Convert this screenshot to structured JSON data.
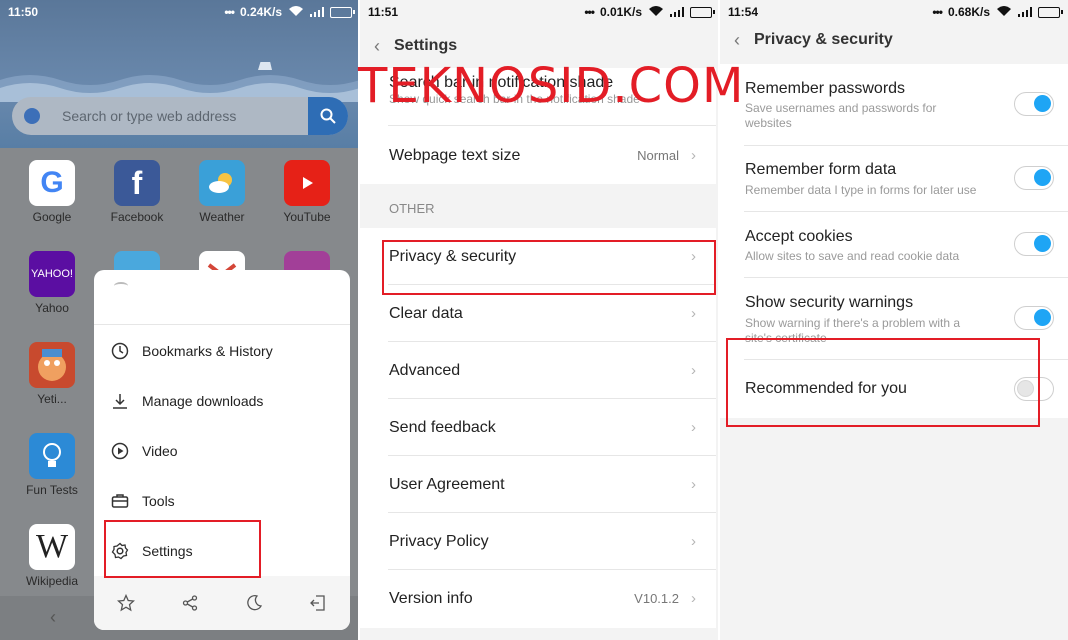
{
  "panel1": {
    "status": {
      "time": "11:50",
      "speed": "0.24K/s"
    },
    "search_placeholder": "Search or type web address",
    "apps": [
      {
        "label": "Google",
        "icon": "google-icon",
        "color": "#ffffff"
      },
      {
        "label": "Facebook",
        "icon": "facebook-icon",
        "color": "#3b5998"
      },
      {
        "label": "Weather",
        "icon": "weather-icon",
        "color": "#3aa0d8"
      },
      {
        "label": "YouTube",
        "icon": "youtube-icon",
        "color": "#e62117"
      },
      {
        "label": "Yahoo",
        "icon": "yahoo-icon",
        "color": "#5b0ea2"
      },
      {
        "label": "Yeti...",
        "icon": "yeti-icon",
        "color": "#c84a2e"
      },
      {
        "label": "Fun Tests",
        "icon": "fun-tests-icon",
        "color": "#2c8ad6"
      },
      {
        "label": "Wikipedia",
        "icon": "wikipedia-icon",
        "color": "#ffffff"
      }
    ],
    "yahoo_logo_text": "YAHOO!",
    "menu": {
      "items": [
        {
          "label": "Bookmarks & History",
          "icon": "clock-icon"
        },
        {
          "label": "Manage downloads",
          "icon": "download-icon"
        },
        {
          "label": "Video",
          "icon": "play-icon"
        },
        {
          "label": "Tools",
          "icon": "toolbox-icon"
        },
        {
          "label": "Settings",
          "icon": "gear-icon"
        }
      ],
      "bottom_icons": [
        "star-icon",
        "share-icon",
        "moon-icon",
        "exit-icon"
      ]
    }
  },
  "panel2": {
    "status": {
      "time": "11:51",
      "speed": "0.01K/s"
    },
    "title": "Settings",
    "partial_row": {
      "title": "Search bar in notification shade",
      "desc": "Show quick search bar in the notification shade"
    },
    "text_size": {
      "label": "Webpage text size",
      "value": "Normal"
    },
    "section": "OTHER",
    "rows": [
      {
        "label": "Privacy & security",
        "value": ""
      },
      {
        "label": "Clear data",
        "value": ""
      },
      {
        "label": "Advanced",
        "value": ""
      },
      {
        "label": "Send feedback",
        "value": ""
      },
      {
        "label": "User Agreement",
        "value": ""
      },
      {
        "label": "Privacy Policy",
        "value": ""
      },
      {
        "label": "Version info",
        "value": "V10.1.2"
      }
    ]
  },
  "panel3": {
    "status": {
      "time": "11:54",
      "speed": "0.68K/s"
    },
    "title": "Privacy & security",
    "rows": [
      {
        "title": "Remember passwords",
        "desc": "Save usernames and passwords for websites",
        "on": true
      },
      {
        "title": "Remember form data",
        "desc": "Remember data I type in forms for later use",
        "on": true
      },
      {
        "title": "Accept cookies",
        "desc": "Allow sites to save and read cookie data",
        "on": true
      },
      {
        "title": "Show security warnings",
        "desc": "Show warning if there's a problem with a site's certificate",
        "on": true
      },
      {
        "title": "Recommended for you",
        "desc": "",
        "on": false
      }
    ]
  },
  "watermark": "TEKNOSID.COM",
  "colors": {
    "highlight": "#e31d26",
    "toggle_on": "#1ea5f5"
  }
}
